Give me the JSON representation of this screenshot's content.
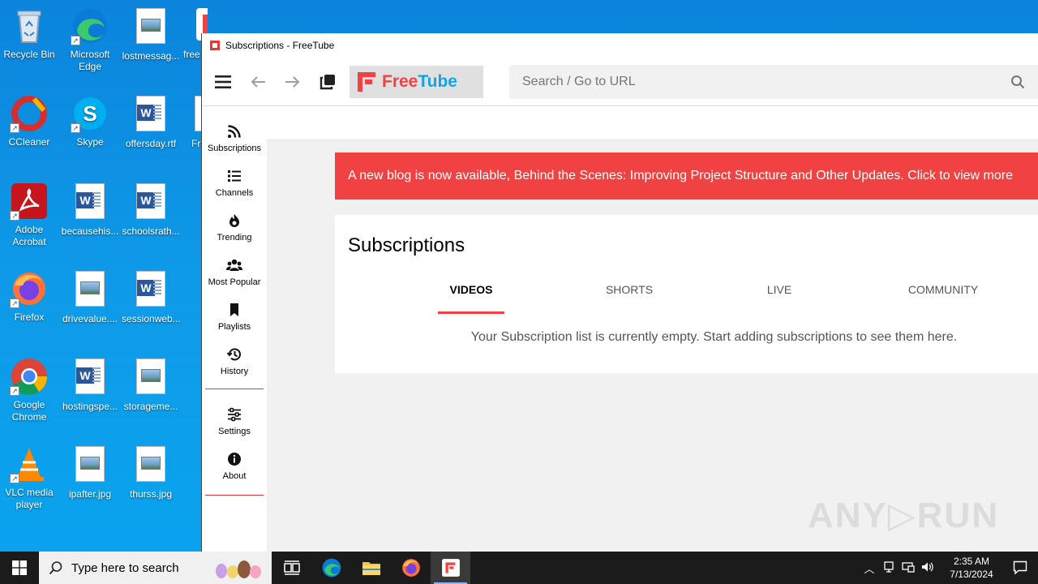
{
  "desktop": {
    "icons": [
      {
        "label": "Recycle Bin"
      },
      {
        "label": "Microsoft Edge"
      },
      {
        "label": "lostmessag..."
      },
      {
        "label": "free"
      },
      {
        "label": "CCleaner"
      },
      {
        "label": "Skype"
      },
      {
        "label": "offersday.rtf"
      },
      {
        "label": "Fr"
      },
      {
        "label": "Adobe Acrobat"
      },
      {
        "label": "becausehis..."
      },
      {
        "label": "schoolsrath..."
      },
      {
        "label": "Firefox"
      },
      {
        "label": "drivevalue...."
      },
      {
        "label": "sessionweb..."
      },
      {
        "label": "Google Chrome"
      },
      {
        "label": "hostingspe..."
      },
      {
        "label": "storageme..."
      },
      {
        "label": "VLC media player"
      },
      {
        "label": "ipafter.jpg"
      },
      {
        "label": "thurss.jpg"
      }
    ]
  },
  "window": {
    "title": "Subscriptions - FreeTube"
  },
  "topbar": {
    "logo_free": "Free",
    "logo_tube": "Tube",
    "search_placeholder": "Search / Go to URL"
  },
  "sidenav": {
    "items": [
      {
        "label": "Subscriptions",
        "icon": "rss-icon"
      },
      {
        "label": "Channels",
        "icon": "list-icon"
      },
      {
        "label": "Trending",
        "icon": "fire-icon"
      },
      {
        "label": "Most Popular",
        "icon": "users-icon"
      },
      {
        "label": "Playlists",
        "icon": "bookmark-icon"
      },
      {
        "label": "History",
        "icon": "history-icon"
      },
      {
        "label": "Settings",
        "icon": "sliders-icon"
      },
      {
        "label": "About",
        "icon": "info-icon"
      }
    ]
  },
  "main": {
    "banner": "A new blog is now available, Behind the Scenes: Improving Project Structure and Other Updates. Click to view more",
    "heading": "Subscriptions",
    "tabs": [
      {
        "label": "VIDEOS",
        "active": true
      },
      {
        "label": "SHORTS",
        "active": false
      },
      {
        "label": "LIVE",
        "active": false
      },
      {
        "label": "COMMUNITY",
        "active": false
      }
    ],
    "empty_message": "Your Subscription list is currently empty. Start adding subscriptions to see them here."
  },
  "taskbar": {
    "search_placeholder": "Type here to search",
    "time": "2:35 AM",
    "date": "7/13/2024"
  },
  "colors": {
    "accent": "#f04242",
    "logo_blue": "#14a4df"
  }
}
